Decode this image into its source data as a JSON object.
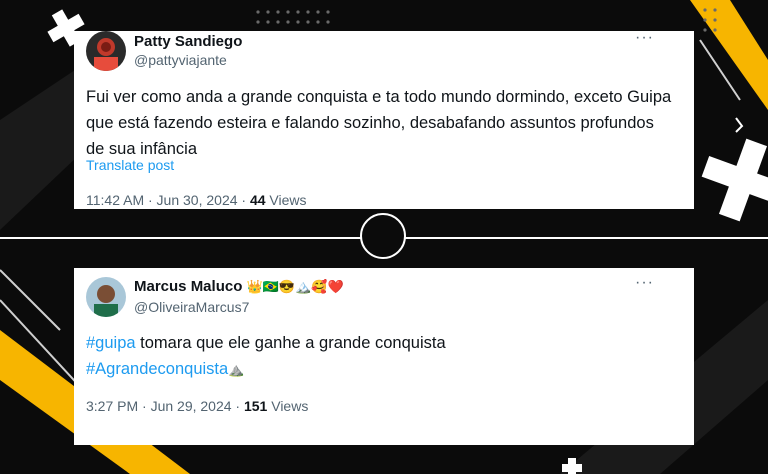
{
  "colors": {
    "link": "#1d9bf0",
    "muted": "#536471",
    "text": "#0f1419",
    "accent": "#f7b500"
  },
  "tweets": [
    {
      "name": "Patty Sandiego",
      "handle": "@pattyviajante",
      "text": "Fui ver como anda a grande conquista e ta todo mundo dormindo, exceto Guipa que está fazendo esteira e falando sozinho, desabafando assuntos profundos de sua infância",
      "translate": "Translate post",
      "time": "11:42 AM · Jun 30, 2024 · ",
      "views_count": "44",
      "views_label": " Views",
      "more": "···"
    },
    {
      "name": "Marcus Maluco",
      "name_emojis": "👑🇧🇷😎🏔️🥰❤️",
      "handle": "@OliveiraMarcus7",
      "hashtag1": "#guipa",
      "text_rest": " tomara que ele ganhe a grande conquista",
      "hashtag2": "#Agrandeconquista",
      "hashtag2_emoji": "⛰️",
      "time": "3:27 PM · Jun 29, 2024 · ",
      "views_count": "151",
      "views_label": " Views",
      "more": "···"
    }
  ]
}
